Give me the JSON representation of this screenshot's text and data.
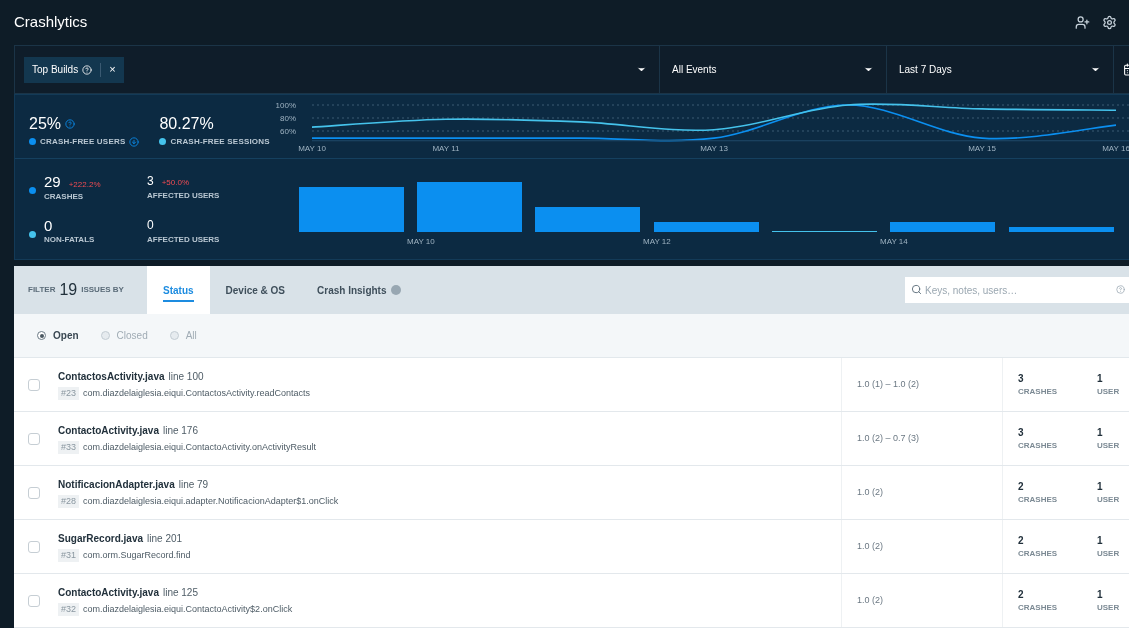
{
  "app": {
    "title": "Crashlytics"
  },
  "filter_bar": {
    "chip": {
      "label": "Top Builds",
      "remove": "×"
    },
    "dropdowns": [
      {
        "value": "All Events"
      },
      {
        "value": "Last 7 Days"
      }
    ]
  },
  "metrics": [
    {
      "value": "25%",
      "help": true,
      "download": true
    },
    {
      "value": "80.27%",
      "help": false,
      "download": false
    }
  ],
  "chart_data": {
    "type": "line",
    "categories": [
      "MAY 10",
      "MAY 11",
      null,
      "MAY 13",
      null,
      "MAY 15",
      "MAY 16"
    ],
    "ylim": [
      45,
      100
    ],
    "yticks": [
      {
        "value": 60,
        "label": "60%"
      },
      {
        "value": 80,
        "label": "80%"
      },
      {
        "value": 100,
        "label": "100%"
      }
    ],
    "series": [
      {
        "name": "CRASH-FREE USERS",
        "color": "#0b8ff0",
        "values": [
          49,
          49,
          49,
          49,
          100,
          49,
          69
        ]
      },
      {
        "name": "CRASH-FREE SESSIONS",
        "color": "#45c3ec",
        "values": [
          66,
          78,
          74,
          62,
          100,
          94,
          92
        ]
      }
    ]
  },
  "counts": [
    {
      "color": "#0b8ff0",
      "value": "29",
      "change": "+222.2%",
      "label": "CRASHES",
      "affected": {
        "value": "3",
        "change": "+50.0%",
        "label": "AFFECTED USERS"
      }
    },
    {
      "color": "#45c3ec",
      "value": "0",
      "label": "NON-FATALS",
      "affected": {
        "value": "0",
        "label": "AFFECTED USERS"
      }
    }
  ],
  "bar_axis_labels": [
    "MAY 10",
    "MAY 12",
    "MAY 14"
  ],
  "issues": {
    "filter": {
      "prefix": "FILTER",
      "count": "19",
      "suffix": "ISSUES BY"
    },
    "tabs": [
      {
        "label": "Status",
        "selected": true,
        "badge": false
      },
      {
        "label": "Device & OS",
        "selected": false,
        "badge": false
      },
      {
        "label": "Crash Insights",
        "selected": false,
        "badge": true
      }
    ],
    "search": {
      "placeholder": "Keys, notes, users…"
    },
    "status_filter": [
      {
        "label": "Open",
        "selected": true
      },
      {
        "label": "Closed",
        "selected": false
      },
      {
        "label": "All",
        "selected": false
      }
    ],
    "rows": [
      {
        "checked": false,
        "file": "ContactosActivity.java",
        "line": "line 100",
        "number": "#23",
        "method": "com.diazdelaiglesia.eiqui.ContactosActivity.readContacts",
        "versions": "1.0 (1) – 1.0 (2)",
        "crashes": "3",
        "crashes_label": "CRASHES",
        "users": "1",
        "users_label": "USER"
      },
      {
        "checked": false,
        "file": "ContactoActivity.java",
        "line": "line 176",
        "number": "#33",
        "method": "com.diazdelaiglesia.eiqui.ContactoActivity.onActivityResult",
        "versions": "1.0 (2) – 0.7 (3)",
        "crashes": "3",
        "crashes_label": "CRASHES",
        "users": "1",
        "users_label": "USER"
      },
      {
        "checked": false,
        "file": "NotificacionAdapter.java",
        "line": "line 79",
        "number": "#28",
        "method": "com.diazdelaiglesia.eiqui.adapter.NotificacionAdapter$1.onClick",
        "versions": "1.0 (2)",
        "crashes": "2",
        "crashes_label": "CRASHES",
        "users": "1",
        "users_label": "USER"
      },
      {
        "checked": false,
        "file": "SugarRecord.java",
        "line": "line 201",
        "number": "#31",
        "method": "com.orm.SugarRecord.find",
        "versions": "1.0 (2)",
        "crashes": "2",
        "crashes_label": "CRASHES",
        "users": "1",
        "users_label": "USER"
      },
      {
        "checked": false,
        "file": "ContactoActivity.java",
        "line": "line 125",
        "number": "#32",
        "method": "com.diazdelaiglesia.eiqui.ContactoActivity$2.onClick",
        "versions": "1.0 (2)",
        "crashes": "2",
        "crashes_label": "CRASHES",
        "users": "1",
        "users_label": "USER"
      }
    ]
  }
}
